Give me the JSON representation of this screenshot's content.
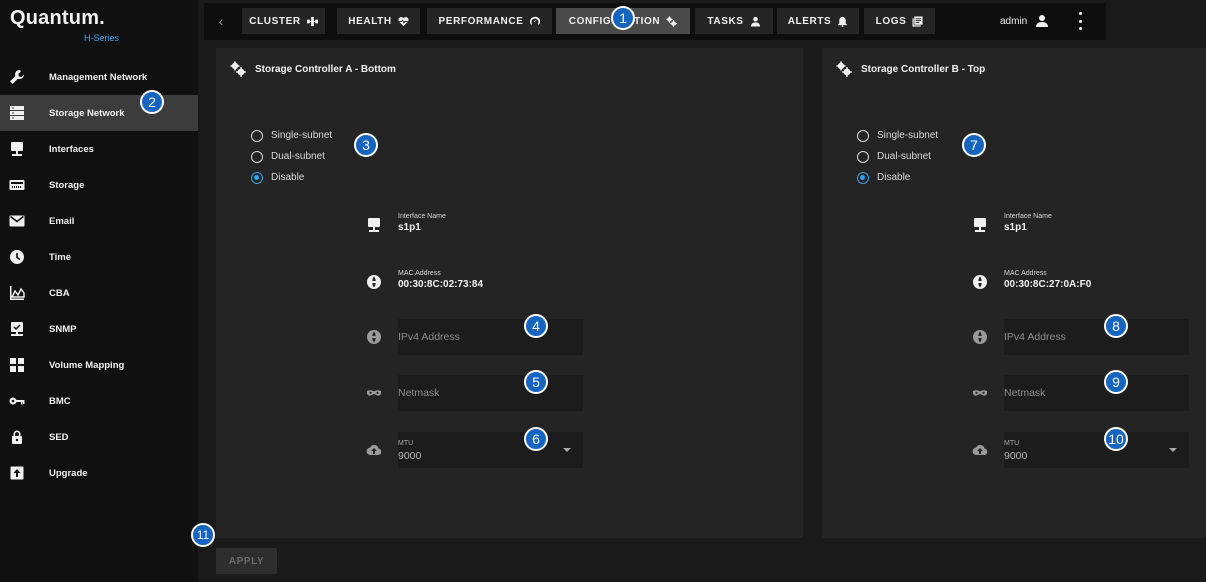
{
  "brand": {
    "name": "Quantum.",
    "series": "H-Series"
  },
  "sidebar": {
    "items": [
      {
        "label": "Management Network",
        "icon": "wrench-icon"
      },
      {
        "label": "Storage Network",
        "icon": "storage-list-icon",
        "active": true
      },
      {
        "label": "Interfaces",
        "icon": "monitor-icon"
      },
      {
        "label": "Storage",
        "icon": "drive-icon"
      },
      {
        "label": "Email",
        "icon": "mail-icon"
      },
      {
        "label": "Time",
        "icon": "clock-icon"
      },
      {
        "label": "CBA",
        "icon": "chart-icon"
      },
      {
        "label": "SNMP",
        "icon": "snmp-icon"
      },
      {
        "label": "Volume Mapping",
        "icon": "grid-icon"
      },
      {
        "label": "BMC",
        "icon": "key-icon"
      },
      {
        "label": "SED",
        "icon": "lock-icon"
      },
      {
        "label": "Upgrade",
        "icon": "upload-icon"
      }
    ]
  },
  "topbar": {
    "back": "‹",
    "tabs": [
      {
        "label": "CLUSTER",
        "icon": "cluster-icon"
      },
      {
        "label": "HEALTH",
        "icon": "heart-pulse-icon"
      },
      {
        "label": "PERFORMANCE",
        "icon": "gauge-icon"
      },
      {
        "label": "CONFIGURATION",
        "icon": "gears-icon",
        "active": true
      },
      {
        "label": "TASKS",
        "icon": "person-icon"
      },
      {
        "label": "ALERTS",
        "icon": "bell-icon"
      },
      {
        "label": "LOGS",
        "icon": "logs-icon"
      }
    ],
    "user": "admin"
  },
  "controller_a": {
    "title": "Storage Controller A - Bottom",
    "radios": [
      {
        "label": "Single-subnet",
        "checked": false
      },
      {
        "label": "Dual-subnet",
        "checked": false
      },
      {
        "label": "Disable",
        "checked": true
      }
    ],
    "interface_label": "Interface Name",
    "interface_value": "s1p1",
    "mac_label": "MAC Address",
    "mac_value": "00:30:8C:02:73:84",
    "ipv4_placeholder": "IPv4 Address",
    "netmask_placeholder": "Netmask",
    "mtu_label": "MTU",
    "mtu_value": "9000"
  },
  "controller_b": {
    "title": "Storage Controller B - Top",
    "radios": [
      {
        "label": "Single-subnet",
        "checked": false
      },
      {
        "label": "Dual-subnet",
        "checked": false
      },
      {
        "label": "Disable",
        "checked": true
      }
    ],
    "interface_label": "Interface Name",
    "interface_value": "s1p1",
    "mac_label": "MAC Address",
    "mac_value": "00:30:8C:27:0A:F0",
    "ipv4_placeholder": "IPv4 Address",
    "netmask_placeholder": "Netmask",
    "mtu_label": "MTU",
    "mtu_value": "9000"
  },
  "apply_label": "APPLY",
  "callouts": [
    "1",
    "2",
    "3",
    "4",
    "5",
    "6",
    "7",
    "8",
    "9",
    "10",
    "11"
  ],
  "colors": {
    "accent": "#3a9fe5",
    "callout": "#1565c0",
    "active_nav": "#3c3c3c"
  }
}
